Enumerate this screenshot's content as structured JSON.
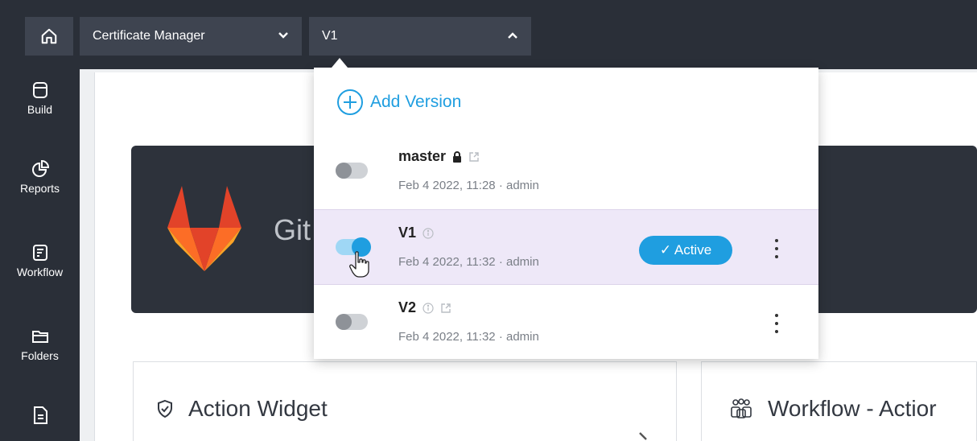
{
  "topbar": {
    "app_select": {
      "value": "Certificate Manager"
    },
    "version_select": {
      "value": "V1"
    }
  },
  "sidebar": {
    "items": [
      {
        "label": "Build",
        "icon": "build-icon"
      },
      {
        "label": "Reports",
        "icon": "reports-icon"
      },
      {
        "label": "Workflow",
        "icon": "workflow-icon"
      },
      {
        "label": "Folders",
        "icon": "folder-icon"
      },
      {
        "label": "",
        "icon": "document-icon"
      }
    ]
  },
  "dropdown": {
    "add_label": "Add Version",
    "versions": [
      {
        "name": "master",
        "meta": "Feb 4 2022, 11:28 · admin",
        "enabled": false
      },
      {
        "name": "V1",
        "meta": "Feb 4 2022, 11:32 · admin",
        "enabled": true,
        "badge": "✓ Active"
      },
      {
        "name": "V2",
        "meta": "Feb 4 2022, 11:32 · admin",
        "enabled": false
      }
    ]
  },
  "main": {
    "banner_text": "Git",
    "cards": [
      {
        "title": "Action Widget",
        "icon": "shield-check-icon"
      },
      {
        "title": "Workflow - Actior",
        "icon": "users-icon"
      }
    ]
  },
  "colors": {
    "accent": "#1f9ee0",
    "topbar_bg": "#2a2f38",
    "active_row_bg": "#eee8f8"
  }
}
